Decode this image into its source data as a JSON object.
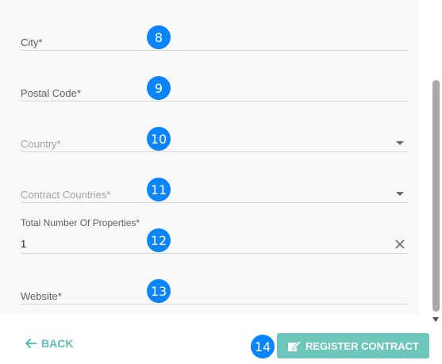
{
  "form": {
    "city": {
      "label": "City*",
      "badge": "8"
    },
    "postal_code": {
      "label": "Postal Code*",
      "badge": "9"
    },
    "country": {
      "label": "Country*",
      "badge": "10"
    },
    "contract_countries": {
      "label": "Contract Countries*",
      "badge": "11"
    },
    "total_properties": {
      "label": "Total Number Of Properties*",
      "value": "1",
      "badge": "12"
    },
    "website": {
      "label": "Website*",
      "badge": "13"
    }
  },
  "footer": {
    "back_label": "BACK",
    "register_label": "REGISTER CONTRACT",
    "register_badge": "14"
  },
  "icons": {
    "back": "arrow-left-icon",
    "register": "pen-document-icon",
    "dropdown": "triangle-down-icon",
    "clear": "close-icon"
  },
  "colors": {
    "accent": "#6cc6b9",
    "badge": "#0a84ff",
    "panel": "#f8f8f8"
  }
}
